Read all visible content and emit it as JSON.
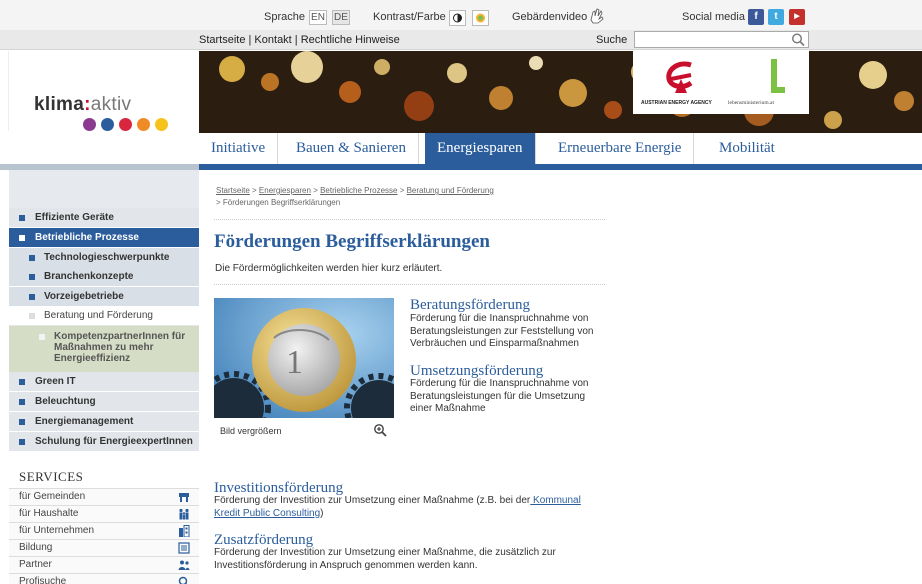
{
  "topbar": {
    "sprache_label": "Sprache",
    "lang_en": "EN",
    "lang_de": "DE",
    "kontrast_label": "Kontrast/Farbe",
    "gebaerden_label": "Gebärdenvideo",
    "social_label": "Social media"
  },
  "secondbar": {
    "links": "Startseite | Kontakt | Rechtliche Hinweise",
    "search_label": "Suche",
    "search_value": ""
  },
  "logo": {
    "brand_bold": "klima",
    "brand_colon": ":",
    "brand_thin": "aktiv",
    "dot_colors": [
      "#8b3a8f",
      "#2b5d9c",
      "#d7263d",
      "#f08a24",
      "#f6c21c"
    ]
  },
  "partners": {
    "ea_caption": "AUSTRIAN ENERGY AGENCY",
    "lm_caption": "lebensministerium.at"
  },
  "nav": {
    "items": [
      "Initiative",
      "Bauen & Sanieren",
      "Energiesparen",
      "Erneuerbare Energie",
      "Mobilität"
    ],
    "active": "Energiesparen"
  },
  "sidebar": {
    "items": [
      "Effiziente Geräte",
      "Betriebliche Prozesse",
      "Technologieschwerpunkte",
      "Branchenkonzepte",
      "Vorzeigebetriebe",
      "Beratung und Förderung",
      "KompetenzpartnerInnen für Maßnahmen zu mehr Energieeffizienz",
      "Green IT",
      "Beleuchtung",
      "Energiemanagement",
      "Schulung für EnergieexpertInnen"
    ],
    "services_title": "SERVICES",
    "services": [
      "für Gemeinden",
      "für Haushalte",
      "für Unternehmen",
      "Bildung",
      "Partner",
      "Profisuche"
    ]
  },
  "breadcrumb": {
    "startseite": "Startseite",
    "energiesparen": "Energiesparen",
    "betriebliche": "Betriebliche Prozesse",
    "beratung": "Beratung und Förderung",
    "current": "Förderungen Begriffserklärungen",
    "sep": " > "
  },
  "main": {
    "title": "Förderungen Begriffserklärungen",
    "intro": "Die Fördermöglichkeiten werden hier kurz erläutert.",
    "image_caption": "Bild vergrößern",
    "sections": [
      {
        "title": "Beratungsförderung",
        "text": "Förderung für die Inanspruchnahme von Beratungsleistungen zur Feststellung von Verbräuchen und Einsparmaßnahmen"
      },
      {
        "title": "Umsetzungsförderung",
        "text": "Förderung für die Inanspruchnahme von Beratungsleistungen für die Umsetzung einer Maßnahme"
      },
      {
        "title": "Investitionsförderung",
        "text_before": "Förderung der Investition zur Umsetzung einer Maßnahme (z.B. bei der",
        "link": " Kommunal Kredit Public Consulting",
        "text_after": ")"
      },
      {
        "title": "Zusatzförderung",
        "text": "Förderung der Investition zur Umsetzung einer Maßnahme, die zusätzlich zur Investitionsförderung in Anspruch genommen werden kann."
      }
    ]
  },
  "colors": {
    "brand_blue": "#2b5d9c",
    "sidebar_bg": "#e2e6ea",
    "sub_bg": "#d6ddc6"
  }
}
